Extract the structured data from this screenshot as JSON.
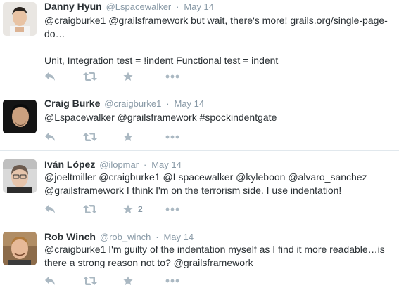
{
  "tweets": [
    {
      "name": "Danny Hyun",
      "handle": "@Lspacewalker",
      "time": "May 14",
      "lines": [
        "@craigburke1 @grailsframework but wait, there's more! grails.org/single-page-",
        "do…",
        "",
        "Unit, Integration test = !indent Functional test = indent"
      ],
      "favorites": ""
    },
    {
      "name": "Craig Burke",
      "handle": "@craigburke1",
      "time": "May 14",
      "lines": [
        "@Lspacewalker @grailsframework #spockindentgate"
      ],
      "favorites": ""
    },
    {
      "name": "Iván López",
      "handle": "@ilopmar",
      "time": "May 14",
      "lines": [
        "@joeltmiller @craigburke1 @Lspacewalker @kyleboon @alvaro_sanchez",
        "@grailsframework I think I'm on the terrorism side. I use indentation!"
      ],
      "favorites": "2"
    },
    {
      "name": "Rob Winch",
      "handle": "@rob_winch",
      "time": "May 14",
      "lines": [
        "@craigburke1 I'm guilty of the indentation myself as I find it more readable…is",
        "there a strong reason not to? @grailsframework"
      ],
      "favorites": ""
    }
  ],
  "separator": "·",
  "icons": {
    "reply": "reply-icon",
    "retweet": "retweet-icon",
    "favorite": "star-icon",
    "more": "more-icon"
  },
  "colors": {
    "name": "#292f33",
    "meta": "#8899a6",
    "action": "#aab8c2",
    "divider": "#e1e8ed"
  }
}
